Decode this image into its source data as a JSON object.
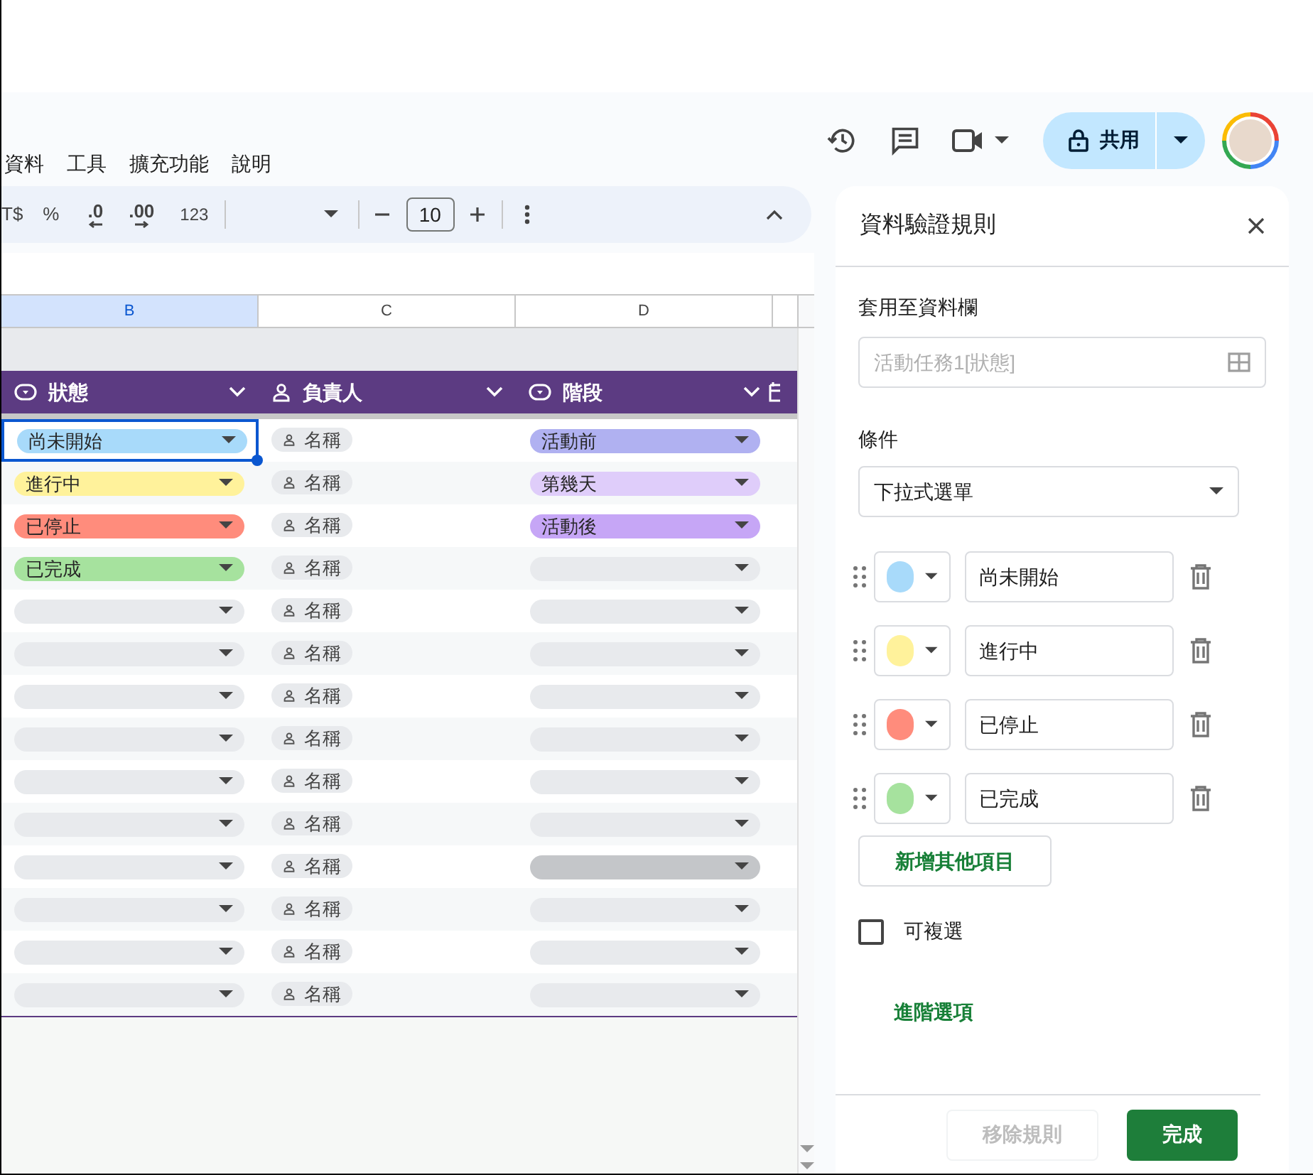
{
  "menu": [
    "資料",
    "工具",
    "擴充功能",
    "說明"
  ],
  "header_actions": {
    "share": "共用"
  },
  "toolbar": {
    "currency": "T$",
    "percent": "%",
    "decrease_decimal": ".0",
    "increase_decimal": ".00",
    "number_format": "123",
    "font_size": "10"
  },
  "columns": [
    {
      "letter": "B",
      "selected": true
    },
    {
      "letter": "C",
      "selected": false
    },
    {
      "letter": "D",
      "selected": false
    },
    {
      "selected": false
    }
  ],
  "table_headers": [
    {
      "label": "狀態",
      "kind": "dropdown"
    },
    {
      "label": "負責人",
      "kind": "person"
    },
    {
      "label": "階段",
      "kind": "dropdown"
    }
  ],
  "rows": [
    {
      "selected": true,
      "status": {
        "label": "尚未開始",
        "color": "#a8dafa"
      },
      "owner": "名稱",
      "stage": {
        "label": "活動前",
        "color": "#b0b1f1",
        "hovered": false
      }
    },
    {
      "selected": false,
      "status": {
        "label": "進行中",
        "color": "#fff29b"
      },
      "owner": "名稱",
      "stage": {
        "label": "第幾天",
        "color": "#dfcdfa",
        "hovered": false
      }
    },
    {
      "selected": false,
      "status": {
        "label": "已停止",
        "color": "#ff8c7c"
      },
      "owner": "名稱",
      "stage": {
        "label": "活動後",
        "color": "#c6a6f6",
        "hovered": false
      }
    },
    {
      "selected": false,
      "status": {
        "label": "已完成",
        "color": "#a6e29e"
      },
      "owner": "名稱",
      "stage": {
        "hovered": false
      }
    },
    {
      "selected": false,
      "status": {},
      "owner": "名稱",
      "stage": {
        "hovered": false
      }
    },
    {
      "selected": false,
      "status": {},
      "owner": "名稱",
      "stage": {
        "hovered": false
      }
    },
    {
      "selected": false,
      "status": {},
      "owner": "名稱",
      "stage": {
        "hovered": false
      }
    },
    {
      "selected": false,
      "status": {},
      "owner": "名稱",
      "stage": {
        "hovered": false
      }
    },
    {
      "selected": false,
      "status": {},
      "owner": "名稱",
      "stage": {
        "hovered": false
      }
    },
    {
      "selected": false,
      "status": {},
      "owner": "名稱",
      "stage": {
        "hovered": false
      }
    },
    {
      "selected": false,
      "status": {},
      "owner": "名稱",
      "stage": {
        "hovered": true
      }
    },
    {
      "selected": false,
      "status": {},
      "owner": "名稱",
      "stage": {
        "hovered": false
      }
    },
    {
      "selected": false,
      "status": {},
      "owner": "名稱",
      "stage": {
        "hovered": false
      }
    },
    {
      "selected": false,
      "status": {},
      "owner": "名稱",
      "stage": {
        "hovered": false
      }
    }
  ],
  "panel": {
    "title": "資料驗證規則",
    "apply_label": "套用至資料欄",
    "apply_placeholder": "活動任務1[狀態]",
    "criteria_label": "條件",
    "criteria_value": "下拉式選單",
    "options": [
      {
        "value": "尚未開始",
        "color": "#a8dafa"
      },
      {
        "value": "進行中",
        "color": "#fff29b"
      },
      {
        "value": "已停止",
        "color": "#ff8c7c"
      },
      {
        "value": "已完成",
        "color": "#a6e29e"
      }
    ],
    "add_item": "新增其他項目",
    "multi_select": {
      "label": "可複選",
      "checked": false
    },
    "advanced": "進階選項",
    "remove_rule": "移除規則",
    "done": "完成"
  }
}
